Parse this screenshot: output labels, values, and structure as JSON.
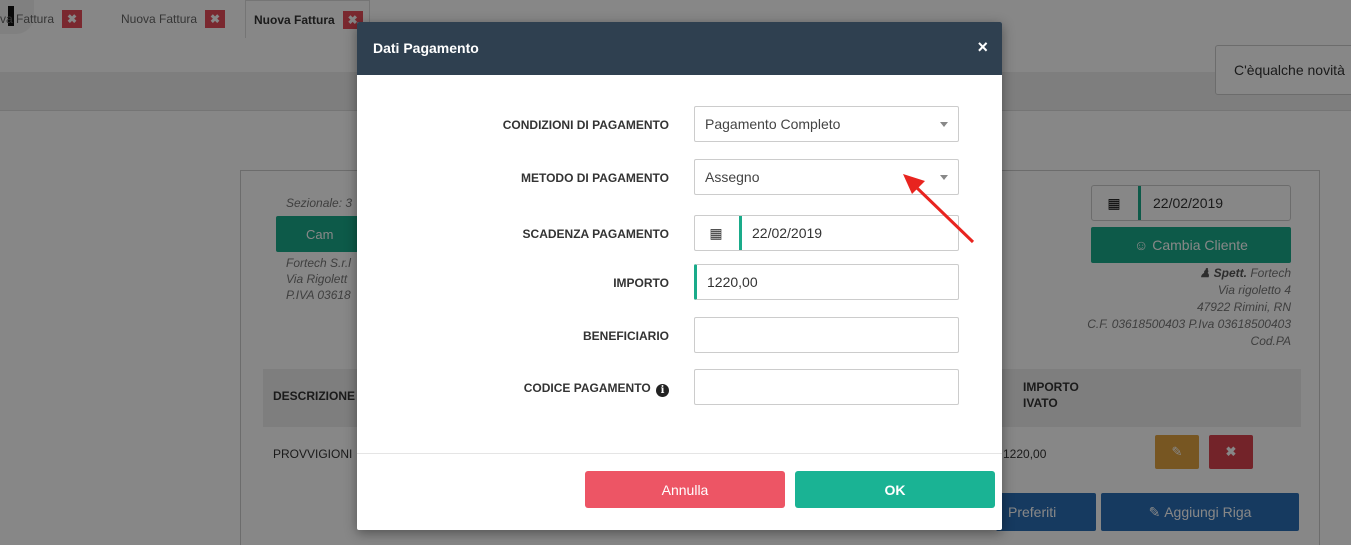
{
  "app": {
    "tabs": [
      {
        "label": "va Fattura"
      },
      {
        "label": "Nuova Fattura"
      },
      {
        "label": "Nuova Fattura"
      }
    ],
    "news_button": "C'èqualche novità",
    "sezionale": "Sezionale: 3",
    "cambia_short": "Cam",
    "company_lines": [
      "Fortech S.r.l",
      "Via Rigolett",
      "P.IVA 03618"
    ],
    "invoice_date": "22/02/2019",
    "cambia_cliente": "Cambia Cliente",
    "client": {
      "name_prefix": "Spett.",
      "name": "Fortech",
      "address": "Via rigoletto 4",
      "city": "47922 Rimini, RN",
      "tax": "C.F. 03618500403 P.Iva 03618500403",
      "codpa": "Cod.PA"
    },
    "table": {
      "col_desc": "DESCRIZIONE",
      "col_importo_1": "IMPORTO",
      "col_importo_2": "IVATO",
      "rows": [
        {
          "desc": "PROVVIGIONI",
          "importo": "1220,00"
        }
      ]
    },
    "preferiti": "Preferiti",
    "aggiungi_riga": "Aggiungi Riga"
  },
  "modal": {
    "title": "Dati Pagamento",
    "close": "×",
    "fields": {
      "condizioni": {
        "label": "CONDIZIONI DI PAGAMENTO",
        "value": "Pagamento Completo"
      },
      "metodo": {
        "label": "METODO DI PAGAMENTO",
        "value": "Assegno"
      },
      "scadenza": {
        "label": "SCADENZA PAGAMENTO",
        "value": "22/02/2019"
      },
      "importo": {
        "label": "IMPORTO",
        "value": "1220,00"
      },
      "beneficiario": {
        "label": "BENEFICIARIO",
        "value": ""
      },
      "codice": {
        "label": "CODICE PAGAMENTO",
        "value": ""
      }
    },
    "cancel": "Annulla",
    "ok": "OK"
  },
  "colors": {
    "header": "#2f4050",
    "accent": "#1ab394",
    "danger": "#ed5565",
    "arrow": "#e8241f"
  }
}
